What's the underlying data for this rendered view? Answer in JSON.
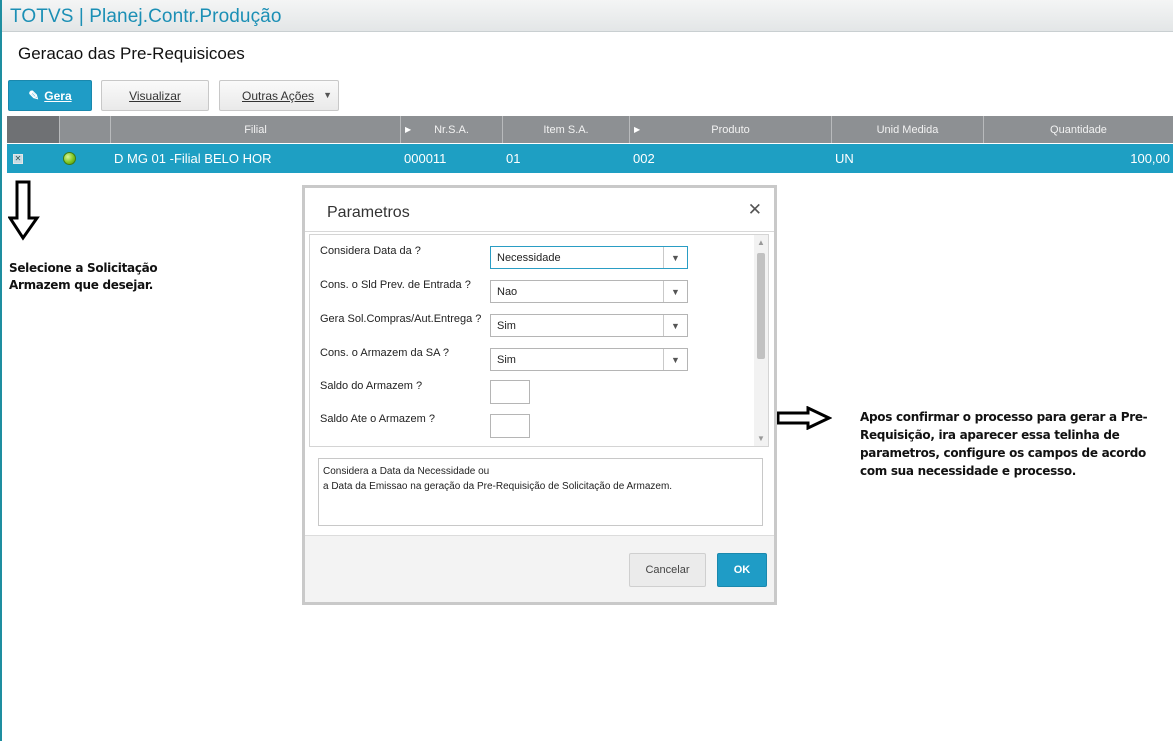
{
  "app": {
    "title": "TOTVS | Planej.Contr.Produção"
  },
  "page": {
    "title": "Geracao das Pre-Requisicoes"
  },
  "toolbar": {
    "gera_label": "Gera",
    "visualizar_label": "Visualizar",
    "outras_label": "Outras Ações"
  },
  "grid": {
    "columns": [
      "Filial",
      "Nr.S.A.",
      "Item S.A.",
      "Produto",
      "Unid Medida",
      "Quantidade"
    ],
    "rows": [
      {
        "filial": "D MG 01 -Filial BELO HOR",
        "nr_sa": "000011",
        "item_sa": "01",
        "produto": "002",
        "unid": "UN",
        "quantidade": "100,00",
        "status_color": "#7fc623"
      }
    ]
  },
  "annotations": {
    "left_note": "Selecione a Solicitação Armazem que desejar.",
    "right_note": "Apos confirmar o processo para gerar a Pre-Requisição, ira aparecer essa telinha de parametros, configure os campos de acordo com sua necessidade e processo."
  },
  "dialog": {
    "title": "Parametros",
    "params": [
      {
        "label": "Considera Data da ?",
        "value": "Necessidade"
      },
      {
        "label": "Cons. o Sld Prev. de Entrada ?",
        "value": "Nao"
      },
      {
        "label": "Gera Sol.Compras/Aut.Entrega ?",
        "value": "Sim"
      },
      {
        "label": "Cons. o Armazem da SA ?",
        "value": "Sim"
      },
      {
        "label": "Saldo do Armazem ?",
        "value": ""
      },
      {
        "label": "Saldo Ate o Armazem ?",
        "value": ""
      }
    ],
    "help": {
      "line1": "Considera a Data da Necessidade ou",
      "line2": "a Data da Emissao na geração da Pre-Requisição de Solicitação de Armazem."
    },
    "cancel_label": "Cancelar",
    "ok_label": "OK"
  },
  "colors": {
    "accent": "#1f9cc6",
    "title": "#1b8fb5",
    "header": "#8d9093"
  }
}
